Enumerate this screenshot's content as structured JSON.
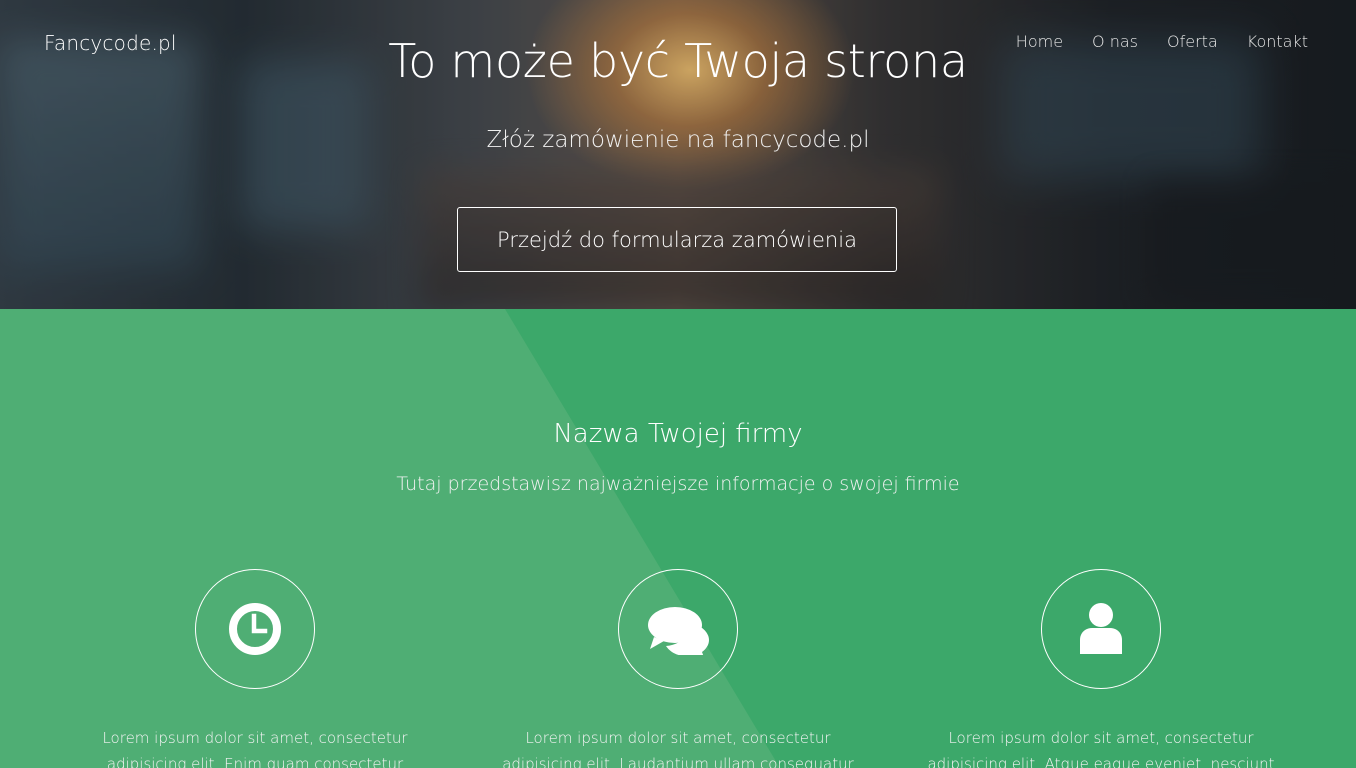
{
  "brand": "Fancycode.pl",
  "nav": [
    "Home",
    "O nas",
    "Oferta",
    "Kontakt"
  ],
  "hero": {
    "title": "To może być Twoja strona",
    "subtitle": "Złóż zamówienie na fancycode.pl",
    "cta": "Przejdź do formularza zamówienia"
  },
  "section": {
    "title": "Nazwa Twojej firmy",
    "tagline": "Tutaj przedstawisz najważniejsze informacje o swojej firmie"
  },
  "features": [
    {
      "icon": "clock-icon",
      "text": "Lorem ipsum dolor sit amet, consectetur adipisicing elit. Enim quam consectetur"
    },
    {
      "icon": "chat-bubbles-icon",
      "text": "Lorem ipsum dolor sit amet, consectetur adipisicing elit. Laudantium ullam consequatur"
    },
    {
      "icon": "user-icon",
      "text": "Lorem ipsum dolor sit amet, consectetur adipisicing elit. Atque eaque eveniet, nesciunt"
    }
  ],
  "colors": {
    "green": "#3ca86a",
    "green_light": "#4fae74",
    "white": "#ffffff"
  }
}
